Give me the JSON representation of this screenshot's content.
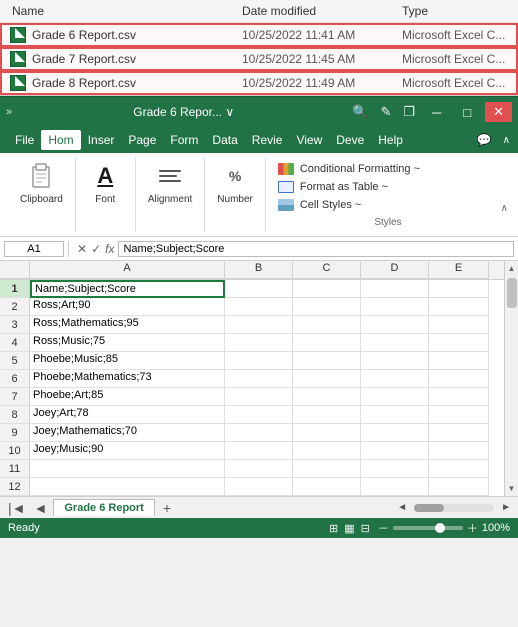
{
  "fileExplorer": {
    "columns": {
      "name": "Name",
      "dateModified": "Date modified",
      "type": "Type"
    },
    "files": [
      {
        "name": "Grade 6 Report.csv",
        "date": "10/25/2022 11:41 AM",
        "type": "Microsoft Excel C...",
        "selected": true
      },
      {
        "name": "Grade 7 Report.csv",
        "date": "10/25/2022 11:45 AM",
        "type": "Microsoft Excel C...",
        "selected": true
      },
      {
        "name": "Grade 8 Report.csv",
        "date": "10/25/2022 11:49 AM",
        "type": "Microsoft Excel C...",
        "selected": true
      }
    ]
  },
  "titleBar": {
    "expand": "»",
    "title": "Grade 6 Repor... ∨",
    "searchIcon": "🔍",
    "editIcon": "✎",
    "restoreIcon": "❐",
    "minimizeChar": "─",
    "maximizeChar": "□",
    "closeChar": "✕"
  },
  "menuBar": {
    "items": [
      "File",
      "Hom",
      "Inser",
      "Page",
      "Form",
      "Data",
      "Revie",
      "View",
      "Deve",
      "Help"
    ],
    "activeItem": "Hom",
    "commentIcon": "💬",
    "expandChar": "∧"
  },
  "ribbon": {
    "groups": [
      {
        "id": "clipboard",
        "label": "Clipboard",
        "hasDropdown": true
      },
      {
        "id": "font",
        "label": "Font",
        "hasDropdown": true
      },
      {
        "id": "alignment",
        "label": "Alignment",
        "hasDropdown": true
      },
      {
        "id": "number",
        "label": "Number",
        "hasDropdown": true
      }
    ],
    "styles": {
      "label": "Styles",
      "conditionalFormatting": "Conditional Formatting ~",
      "formatAsTable": "Format as Table ~",
      "cellStyles": "Cell Styles ~"
    }
  },
  "formulaBar": {
    "cellRef": "A1",
    "checkChar": "✓",
    "crossChar": "✕",
    "fxLabel": "fx",
    "formula": "Name;Subject;Score"
  },
  "spreadsheet": {
    "columns": [
      "A",
      "B",
      "C",
      "D",
      "E"
    ],
    "rows": [
      {
        "num": 1,
        "a": "Name;Subject;Score",
        "b": "",
        "c": "",
        "d": "",
        "e": ""
      },
      {
        "num": 2,
        "a": "Ross;Art;90",
        "b": "",
        "c": "",
        "d": "",
        "e": ""
      },
      {
        "num": 3,
        "a": "Ross;Mathematics;95",
        "b": "",
        "c": "",
        "d": "",
        "e": ""
      },
      {
        "num": 4,
        "a": "Ross;Music;75",
        "b": "",
        "c": "",
        "d": "",
        "e": ""
      },
      {
        "num": 5,
        "a": "Phoebe;Music;85",
        "b": "",
        "c": "",
        "d": "",
        "e": ""
      },
      {
        "num": 6,
        "a": "Phoebe;Mathematics;73",
        "b": "",
        "c": "",
        "d": "",
        "e": ""
      },
      {
        "num": 7,
        "a": "Phoebe;Art;85",
        "b": "",
        "c": "",
        "d": "",
        "e": ""
      },
      {
        "num": 8,
        "a": "Joey;Art;78",
        "b": "",
        "c": "",
        "d": "",
        "e": ""
      },
      {
        "num": 9,
        "a": "Joey;Mathematics;70",
        "b": "",
        "c": "",
        "d": "",
        "e": ""
      },
      {
        "num": 10,
        "a": "Joey;Music;90",
        "b": "",
        "c": "",
        "d": "",
        "e": ""
      },
      {
        "num": 11,
        "a": "",
        "b": "",
        "c": "",
        "d": "",
        "e": ""
      },
      {
        "num": 12,
        "a": "",
        "b": "",
        "c": "",
        "d": "",
        "e": ""
      }
    ],
    "activeCell": "A1"
  },
  "sheetTabs": {
    "activeTab": "Grade 6 Report",
    "addIcon": "+"
  },
  "statusBar": {
    "readyText": "Ready",
    "zoomPercent": "100%"
  }
}
